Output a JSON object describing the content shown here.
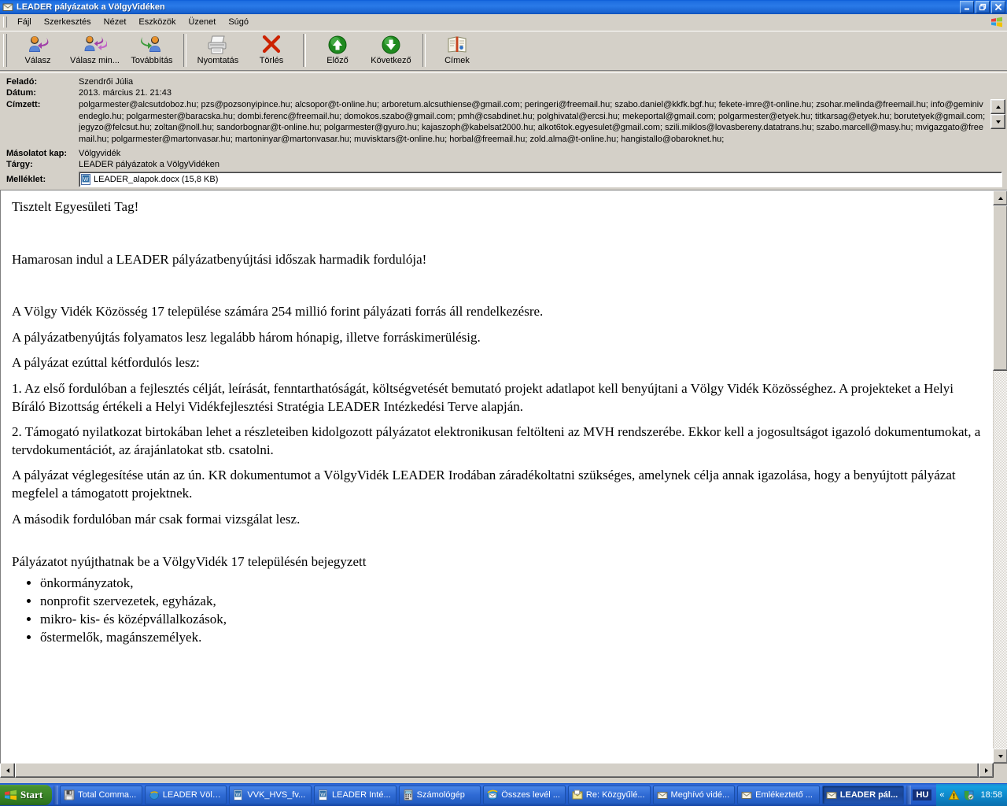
{
  "window": {
    "title": "LEADER pályázatok a VölgyVidéken",
    "icon": "envelope-icon",
    "buttons": {
      "minimize": "_",
      "maximize": "▣",
      "close": "✕"
    }
  },
  "menubar": {
    "items": [
      {
        "label": "Fájl",
        "name": "menu-file"
      },
      {
        "label": "Szerkesztés",
        "name": "menu-edit"
      },
      {
        "label": "Nézet",
        "name": "menu-view"
      },
      {
        "label": "Eszközök",
        "name": "menu-tools"
      },
      {
        "label": "Üzenet",
        "name": "menu-message"
      },
      {
        "label": "Súgó",
        "name": "menu-help"
      }
    ],
    "logo": "windows-logo-icon"
  },
  "toolbar": {
    "buttons": [
      {
        "label": "Válasz",
        "icon": "reply-icon"
      },
      {
        "label": "Válasz min...",
        "icon": "reply-all-icon"
      },
      {
        "label": "Továbbítás",
        "icon": "forward-icon"
      },
      {
        "label": "Nyomtatás",
        "icon": "printer-icon"
      },
      {
        "label": "Törlés",
        "icon": "delete-x-icon"
      },
      {
        "label": "Előző",
        "icon": "previous-up-arrow-icon"
      },
      {
        "label": "Következő",
        "icon": "next-down-arrow-icon"
      },
      {
        "label": "Címek",
        "icon": "address-book-icon"
      }
    ]
  },
  "header": {
    "from_label": "Feladó:",
    "from_value": "Szendrői Júlia",
    "date_label": "Dátum:",
    "date_value": "2013. március 21. 21:43",
    "to_label": "Címzett:",
    "to_value": "polgarmester@alcsutdoboz.hu; pzs@pozsonyipince.hu; alcsopor@t-online.hu; arboretum.alcsuthiense@gmail.com; peringeri@freemail.hu; szabo.daniel@kkfk.bgf.hu; fekete-imre@t-online.hu; zsohar.melinda@freemail.hu; info@geminivendeglo.hu; polgarmester@baracska.hu; dombi.ferenc@freemail.hu; domokos.szabo@gmail.com; pmh@csabdinet.hu; polghivatal@ercsi.hu; mekeportal@gmail.com; polgarmester@etyek.hu; titkarsag@etyek.hu; borutetyek@gmail.com; jegyzo@felcsut.hu; zoltan@noll.hu; sandorbognar@t-online.hu; polgarmester@gyuro.hu; kajaszoph@kabelsat2000.hu; alkot6tok.egyesulet@gmail.com; szili.miklos@lovasbereny.datatrans.hu; szabo.marcell@masy.hu; mvigazgato@freemail.hu; polgarmester@martonvasar.hu; martoninyar@martonvasar.hu; muvisktars@t-online.hu; horbal@freemail.hu; zold.alma@t-online.hu; hangistallo@obaroknet.hu;",
    "cc_label": "Másolatot kap:",
    "cc_value": "Völgyvidék",
    "subject_label": "Tárgy:",
    "subject_value": "LEADER pályázatok a VölgyVidéken",
    "attachment_label": "Melléklet:",
    "attachment_name": "LEADER_alapok.docx (15,8 KB)",
    "attachment_icon": "word-document-icon"
  },
  "body": {
    "greeting": "Tisztelt Egyesületi Tag!",
    "intro": "Hamarosan indul a LEADER pályázatbenyújtási időszak harmadik fordulója!",
    "paragraphs": [
      "A Völgy Vidék Közösség 17 települése számára 254 millió forint pályázati forrás áll rendelkezésre.",
      "A pályázatbenyújtás folyamatos lesz legalább három hónapig, illetve forráskimerülésig.",
      "A pályázat ezúttal kétfordulós lesz:",
      "1.   Az első fordulóban a fejlesztés célját, leírását, fenntarthatóságát, költségvetését bemutató projekt adatlapot kell benyújtani a Völgy Vidék Közösséghez. A projekteket a Helyi Bíráló Bizottság értékeli a Helyi Vidékfejlesztési Stratégia LEADER Intézkedési Terve alapján.",
      "2.   Támogató nyilatkozat birtokában lehet a részleteiben kidolgozott pályázatot elektronikusan feltölteni az MVH rendszerébe. Ekkor kell a jogosultságot igazoló dokumentumokat, a tervdokumentációt, az árajánlatokat stb. csatolni.",
      "A pályázat véglegesítése után az ún. KR dokumentumot a VölgyVidék LEADER Irodában záradékoltatni szükséges, amelynek célja annak igazolása, hogy a benyújtott pályázat megfelel a támogatott projektnek.",
      "A második fordulóban már csak formai vizsgálat lesz."
    ],
    "list_intro": "Pályázatot nyújthatnak be a VölgyVidék 17 településén bejegyzett",
    "list_items": [
      "önkormányzatok,",
      "nonprofit szervezetek, egyházak,",
      "mikro- kis- és középvállalkozások,",
      "őstermelők, magánszemélyek."
    ]
  },
  "taskbar": {
    "start_label": "Start",
    "tasks": [
      {
        "label": "Total Comma...",
        "icon": "floppy-disk-icon",
        "active": false
      },
      {
        "label": "LEADER Völg...",
        "icon": "internet-explorer-icon",
        "active": false
      },
      {
        "label": "VVK_HVS_fv...",
        "icon": "word-document-icon",
        "active": false
      },
      {
        "label": "LEADER Inté...",
        "icon": "word-document-icon",
        "active": false
      },
      {
        "label": "Számológép",
        "icon": "calculator-icon",
        "active": false
      },
      {
        "label": "Összes levél ...",
        "icon": "outlook-express-icon",
        "active": false
      },
      {
        "label": "Re: Közgyűlé...",
        "icon": "mail-open-icon",
        "active": false
      },
      {
        "label": "Meghívó vidé...",
        "icon": "envelope-icon",
        "active": false
      },
      {
        "label": "Emlékeztető ...",
        "icon": "envelope-icon",
        "active": false
      },
      {
        "label": "LEADER pál...",
        "icon": "envelope-icon",
        "active": true
      }
    ],
    "language": "HU",
    "tray": {
      "chevron": "«",
      "icons": [
        "security-alert-icon",
        "shield-icon"
      ],
      "clock": "18:58"
    }
  },
  "colors": {
    "titlebar_blue": "#2a7ae8",
    "face": "#d4d0c8",
    "taskbar_blue": "#2f6bd8",
    "start_green": "#3b8528",
    "delete_red": "#cc2200",
    "nav_green": "#2e9e2e"
  }
}
